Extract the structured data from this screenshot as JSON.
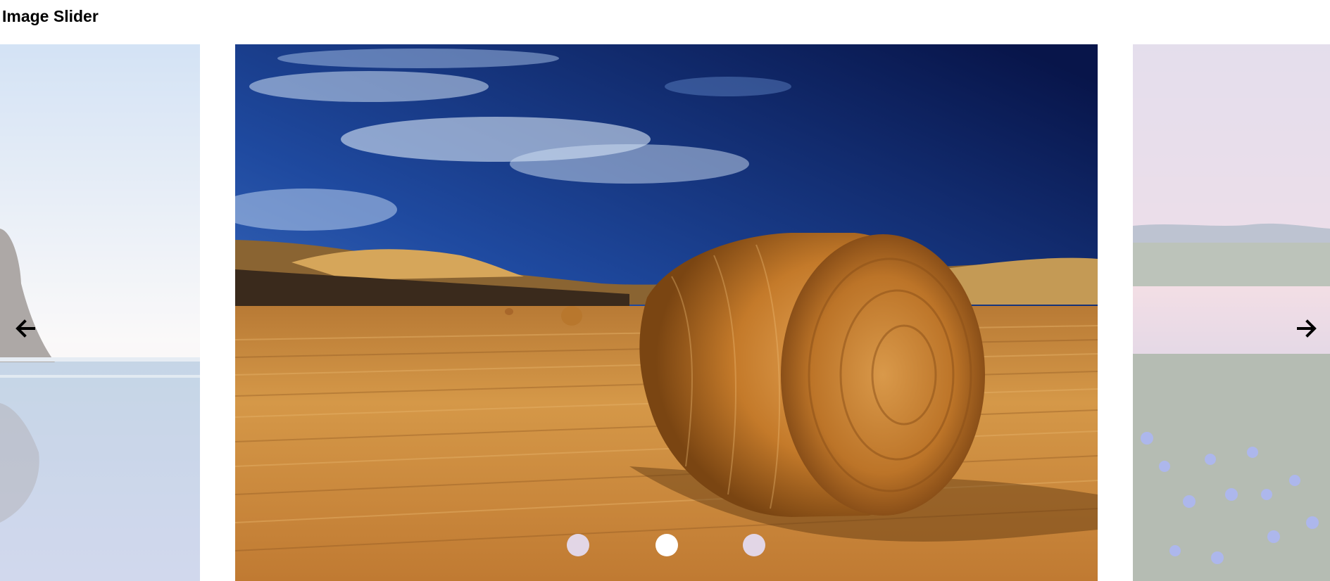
{
  "page": {
    "title": "Image Slider"
  },
  "slider": {
    "current_index": 1,
    "slides": [
      {
        "name": "coastal-rock-beach",
        "state": "previous"
      },
      {
        "name": "hay-bale-field",
        "state": "active"
      },
      {
        "name": "lake-with-wildflowers",
        "state": "next"
      }
    ],
    "prev_icon": "arrow-left-icon",
    "next_icon": "arrow-right-icon",
    "dots": [
      {
        "active": false,
        "color": "#e2d6e6"
      },
      {
        "active": true,
        "color": "#ffffff"
      },
      {
        "active": false,
        "color": "#e2d6e6"
      }
    ]
  },
  "colors": {
    "sky_top": "#0a1e5a",
    "sky_mid": "#1e4fa8",
    "field": "#c98a3a",
    "hay": "#c47a2a",
    "arrow": "#000000"
  }
}
